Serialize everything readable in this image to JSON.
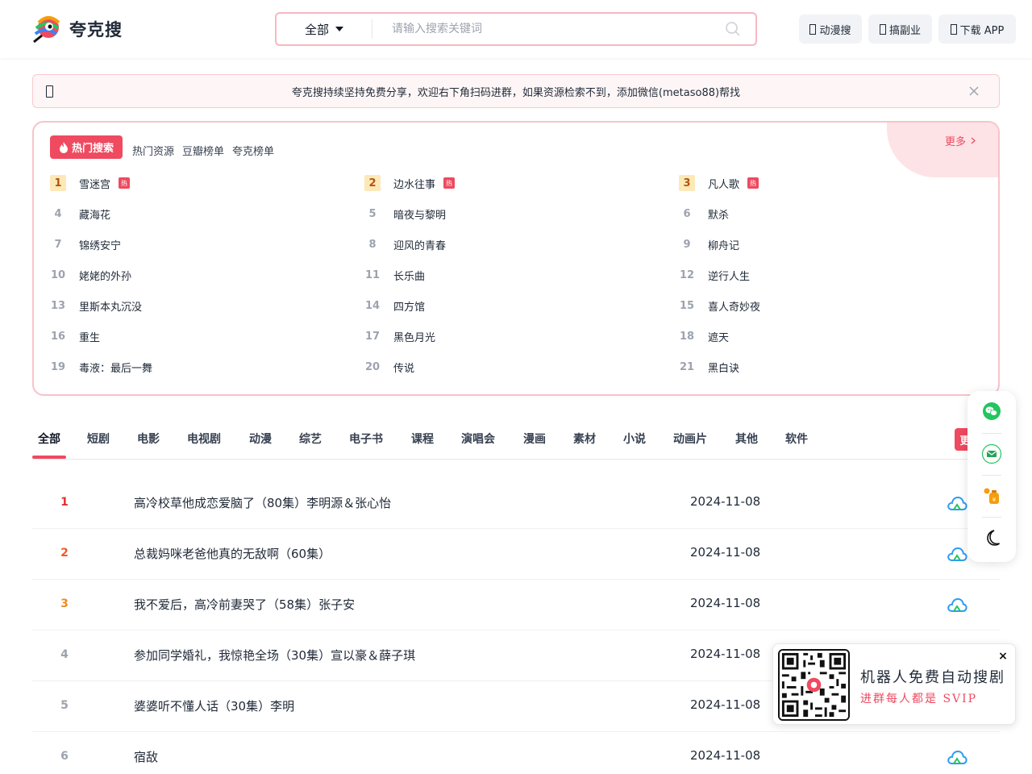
{
  "header": {
    "logo_text": "夸克搜",
    "search": {
      "category": "全部",
      "placeholder": "请输入搜索关键词"
    },
    "buttons": [
      {
        "label": "动漫搜"
      },
      {
        "label": "搞副业"
      },
      {
        "label": "下载 APP"
      }
    ]
  },
  "notice": {
    "text": "夸克搜持续坚持免费分享，欢迎右下角扫码进群，如果资源检索不到，添加微信(metaso88)帮找"
  },
  "hot": {
    "badge": "热门搜索",
    "tabs": [
      "热门资源",
      "豆瓣榜单",
      "夸克榜单"
    ],
    "more": "更多",
    "hot_tag": "热",
    "items": [
      {
        "rank": "1",
        "title": "雪迷宫"
      },
      {
        "rank": "2",
        "title": "边水往事"
      },
      {
        "rank": "3",
        "title": "凡人歌"
      },
      {
        "rank": "4",
        "title": "藏海花"
      },
      {
        "rank": "5",
        "title": "暗夜与黎明"
      },
      {
        "rank": "6",
        "title": "默杀"
      },
      {
        "rank": "7",
        "title": "锦绣安宁"
      },
      {
        "rank": "8",
        "title": "迎风的青春"
      },
      {
        "rank": "9",
        "title": "柳舟记"
      },
      {
        "rank": "10",
        "title": "姥姥的外孙"
      },
      {
        "rank": "11",
        "title": "长乐曲"
      },
      {
        "rank": "12",
        "title": "逆行人生"
      },
      {
        "rank": "13",
        "title": "里斯本丸沉没"
      },
      {
        "rank": "14",
        "title": "四方馆"
      },
      {
        "rank": "15",
        "title": "喜人奇妙夜"
      },
      {
        "rank": "16",
        "title": "重生"
      },
      {
        "rank": "17",
        "title": "黑色月光"
      },
      {
        "rank": "18",
        "title": "遮天"
      },
      {
        "rank": "19",
        "title": "毒液：最后一舞"
      },
      {
        "rank": "20",
        "title": "传说"
      },
      {
        "rank": "21",
        "title": "黑白诀"
      }
    ]
  },
  "categories": {
    "tabs": [
      "全部",
      "短剧",
      "电影",
      "电视剧",
      "动漫",
      "综艺",
      "电子书",
      "课程",
      "演唱会",
      "漫画",
      "素材",
      "小说",
      "动画片",
      "其他",
      "软件"
    ],
    "active": "全部",
    "button_fragment": "更"
  },
  "results": [
    {
      "rank": "1",
      "title": "高冷校草他成恋爱脑了（80集）李明源＆张心怡",
      "date": "2024-11-08",
      "rank_color": "#e0312f"
    },
    {
      "rank": "2",
      "title": "总裁妈咪老爸他真的无敌啊（60集）",
      "date": "2024-11-08",
      "rank_color": "#ee5a24"
    },
    {
      "rank": "3",
      "title": "我不爱后，高冷前妻哭了（58集）张子安",
      "date": "2024-11-08",
      "rank_color": "#f08c1c"
    },
    {
      "rank": "4",
      "title": "参加同学婚礼，我惊艳全场（30集）宣以豪＆薛子琪",
      "date": "2024-11-08",
      "rank_color": "#9ca3af"
    },
    {
      "rank": "5",
      "title": "婆婆听不懂人话（30集）李明",
      "date": "2024-11-08",
      "rank_color": "#9ca3af"
    },
    {
      "rank": "6",
      "title": "宿敌",
      "date": "2024-11-08",
      "rank_color": "#9ca3af"
    }
  ],
  "qr_popup": {
    "line1": "机器人免费自动搜剧",
    "line2": "进群每人都是 SVIP",
    "close": "×"
  },
  "colors": {
    "accent": "#ef4a5f",
    "accent_light": "#fde3e6",
    "cloud": "#2f9cf5"
  }
}
